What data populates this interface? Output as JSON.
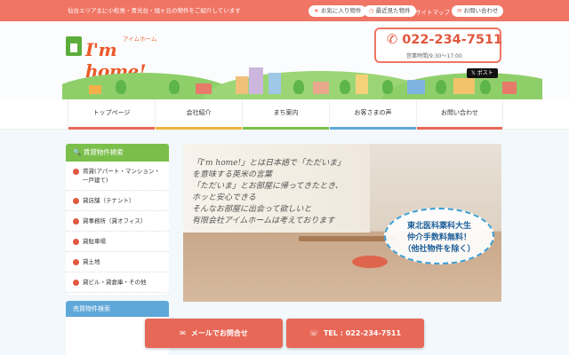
{
  "topbar": {
    "tagline": "仙台エリア主に小松島・青光台・旭ヶ丘の物件をご紹介しています",
    "favorites": "お気に入り物件",
    "recent": "最近見た物件",
    "sitemap": "サイトマップ",
    "contact": "お問い合わせ",
    "icons": [
      "star-icon",
      "clock-icon",
      "mail-icon"
    ]
  },
  "header": {
    "logo_kana": "アイムホーム",
    "logo_text": "I'm home!",
    "phone": "022-234-7511",
    "hours": "営業時間/9:30～17:00",
    "post_button": "ポスト",
    "post_icon": "x-icon"
  },
  "nav": {
    "items": [
      {
        "label": "トップページ",
        "color": "#e86857"
      },
      {
        "label": "会社紹介",
        "color": "#f0b43c"
      },
      {
        "label": "まち案内",
        "color": "#7bbf4b"
      },
      {
        "label": "お客さまの声",
        "color": "#5fa7d9"
      },
      {
        "label": "お問い合わせ",
        "color": "#e86857"
      }
    ]
  },
  "sidebar": {
    "title": "賃貸物件検索",
    "title_icon": "search-icon",
    "items": [
      {
        "label": "賃貸(アパート・マンション・一戸建て)"
      },
      {
        "label": "貸店舗（テナント）"
      },
      {
        "label": "貸事務所（貸オフィス）"
      },
      {
        "label": "貸駐車場"
      },
      {
        "label": "貸土地"
      },
      {
        "label": "貸ビル・貸倉庫・その他"
      }
    ],
    "second_title": "売買物件検索"
  },
  "hero": {
    "line1": "「I'm home!」とは日本語で「ただいま」",
    "line2": "を意味する英米の言葉",
    "line3": "「ただいま」とお部屋に帰ってきたとき、",
    "line4": "ホッと安心できる",
    "line5": "そんなお部屋に出会って欲しいと",
    "line6": "有限会社アイムホームは考えております",
    "badge1": "東北医科薬科大生",
    "badge2": "仲介手数料無料！",
    "badge3": "（他社物件を除く）"
  },
  "floating": {
    "mail": "メールでお問合せ",
    "tel": "TEL : 022-234-7511"
  },
  "colors": {
    "brand": "#f07565",
    "accent_green": "#7bbf4b",
    "accent_blue": "#5fa7d9"
  }
}
